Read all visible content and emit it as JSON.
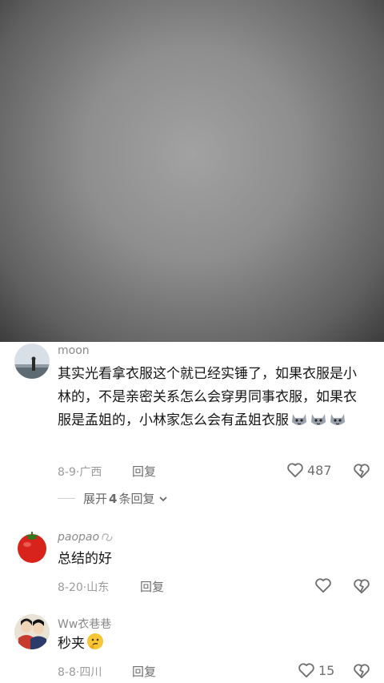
{
  "comments": [
    {
      "username": "moon",
      "text": "其实光看拿衣服这个就已经实锤了，如果衣服是小林的，不是亲密关系怎么会穿男同事衣服，如果衣服是孟姐的，小林家怎么会有孟姐衣服",
      "date": "8-9",
      "location": "广西",
      "reply_label": "回复",
      "likes": "487",
      "emojis": [
        "cat-face-emoji",
        "cat-face-emoji",
        "cat-face-emoji"
      ],
      "expand_prefix": "展开",
      "expand_count": "4",
      "expand_suffix": "条回复"
    },
    {
      "username": "paopao",
      "text": "总结的好",
      "date": "8-20",
      "location": "山东",
      "reply_label": "回复",
      "likes": ""
    },
    {
      "username": "Ww衣巷巷",
      "text": "秒夹",
      "date": "8-8",
      "location": "四川",
      "reply_label": "回复",
      "likes": "15"
    }
  ],
  "colors": {
    "text": "#161616",
    "muted": "#9b9b9b",
    "username": "#8a8a8a"
  }
}
